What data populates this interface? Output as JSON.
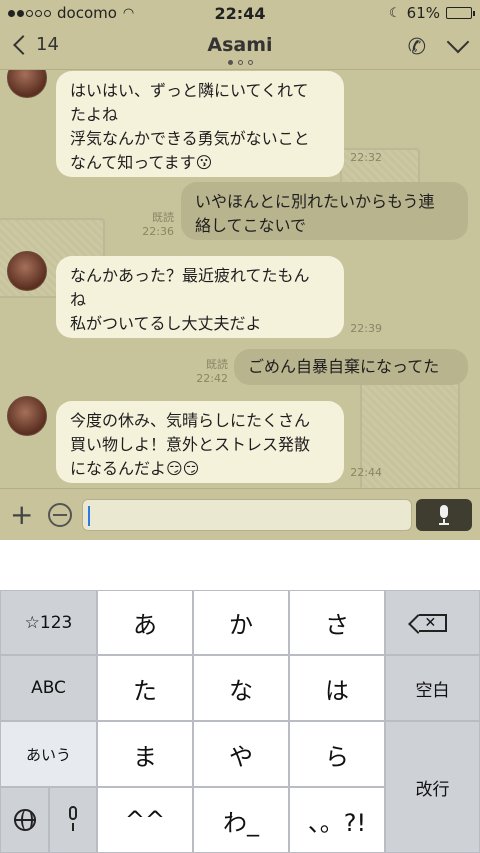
{
  "status": {
    "carrier": "docomo",
    "time": "22:44",
    "battery": "61%",
    "battery_level": 0.61
  },
  "nav": {
    "back_count": "14",
    "title": "Asami"
  },
  "messages": [
    {
      "side": "in",
      "text": "はいはい、ずっと隣にいてくれて\nたよね\n浮気なんかできる勇気がないこと\nなんて知ってます😗",
      "time": "22:32"
    },
    {
      "side": "out",
      "text": "いやほんとに別れたいからもう連\n絡してこないで",
      "read": "既読",
      "time": "22:36"
    },
    {
      "side": "in",
      "text": "なんかあった？最近疲れてたもん\nね\n私がついてるし大丈夫だよ",
      "time": "22:39"
    },
    {
      "side": "out",
      "text": "ごめん自暴自棄になってた",
      "read": "既読",
      "time": "22:42"
    },
    {
      "side": "in",
      "text": "今度の休み、気晴らしにたくさん\n買い物しよ！意外とストレス発散\nになるんだよ😏😏",
      "time": "22:44"
    }
  ],
  "input": {
    "value": ""
  },
  "keyboard": {
    "left": [
      "☆123",
      "ABC",
      "あいう"
    ],
    "keys": [
      "あ",
      "か",
      "さ",
      "た",
      "な",
      "は",
      "ま",
      "や",
      "ら",
      "^^",
      "わ_",
      "、。?!"
    ],
    "space": "空白",
    "enter": "改行"
  },
  "colors": {
    "chat_bg": "#c7c39b",
    "bubble_in": "#f5f2dc",
    "bubble_out": "#b8b48e",
    "bar": "#c8c39a"
  }
}
